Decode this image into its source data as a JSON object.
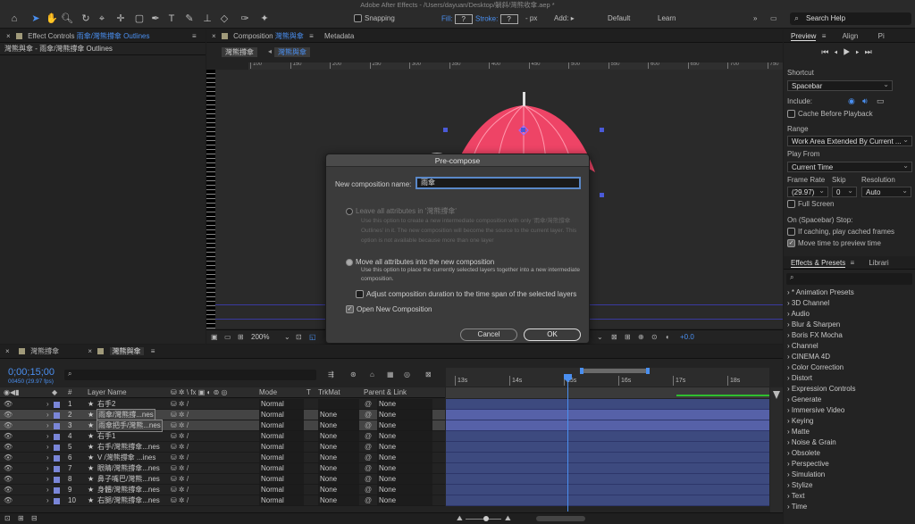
{
  "titlebar": {
    "text": "Adobe After Effects - /Users/dayuan/Desktop/躺斜/灣熊收傘.aep *"
  },
  "toolbar": {
    "snapping_label": "Snapping",
    "fill_label": "Fill:",
    "fill_value": "?",
    "stroke_label": "Stroke:",
    "stroke_value": "?",
    "stroke_px": "- px",
    "add_label": "Add:",
    "workspace_default": "Default",
    "workspace_learn": "Learn",
    "search_placeholder": "Search Help"
  },
  "effect_controls": {
    "tab_label": "Effect Controls",
    "tab_layer": "雨傘/灣熊撐傘 Outlines",
    "subheader": "灣熊與傘 - 雨傘/灣熊撐傘 Outlines"
  },
  "composition": {
    "tab_label": "Composition",
    "tab_name": "灣熊與傘",
    "metadata_tab": "Metadata",
    "breadcrumb_1": "灣熊撐傘",
    "breadcrumb_2": "灣熊與傘",
    "ruler_ticks": [
      "100",
      "150",
      "200",
      "250",
      "300",
      "350",
      "400",
      "450",
      "500",
      "550",
      "600",
      "650",
      "700",
      "750"
    ],
    "zoom": "200%",
    "exposure": "+0.0"
  },
  "dialog": {
    "title": "Pre-compose",
    "name_label": "New composition name:",
    "name_value": "雨傘",
    "opt1_label": "Leave all attributes in '灣熊撐傘'",
    "opt1_desc": "Use this option to create a new intermediate composition with only '雨傘/灣熊撐傘 Outlines' in it. The new composition will become the source to the current layer. This option is not available because more than one layer",
    "opt2_label": "Move all attributes into the new composition",
    "opt2_desc": "Use this option to place the currently selected layers together into a new intermediate composition.",
    "adjust_label": "Adjust composition duration to the time span of the selected layers",
    "open_label": "Open New Composition",
    "cancel": "Cancel",
    "ok": "OK"
  },
  "preview": {
    "tab_preview": "Preview",
    "tab_align": "Align",
    "tab_pi": "Pi",
    "shortcut_label": "Shortcut",
    "shortcut_value": "Spacebar",
    "include_label": "Include:",
    "cache_label": "Cache Before Playback",
    "range_label": "Range",
    "range_value": "Work Area Extended By Current ...",
    "play_from_label": "Play From",
    "play_from_value": "Current Time",
    "frame_rate_label": "Frame Rate",
    "frame_rate_value": "(29.97)",
    "skip_label": "Skip",
    "skip_value": "0",
    "resolution_label": "Resolution",
    "resolution_value": "Auto",
    "full_screen_label": "Full Screen",
    "stop_label": "On (Spacebar) Stop:",
    "if_caching_label": "If caching, play cached frames",
    "move_time_label": "Move time to preview time"
  },
  "effects": {
    "tab_effects": "Effects & Presets",
    "tab_libraries": "Librari",
    "items": [
      "* Animation Presets",
      "3D Channel",
      "Audio",
      "Blur & Sharpen",
      "Boris FX Mocha",
      "Channel",
      "CINEMA 4D",
      "Color Correction",
      "Distort",
      "Expression Controls",
      "Generate",
      "Immersive Video",
      "Keying",
      "Matte",
      "Noise & Grain",
      "Obsolete",
      "Perspective",
      "Simulation",
      "Stylize",
      "Text",
      "Time"
    ]
  },
  "timeline": {
    "tab_1": "灣熊撐傘",
    "tab_2": "灣熊與傘",
    "timecode": "0;00;15;00",
    "frames": "00450 (29.97 fps)",
    "col_num": "#",
    "col_layer_name": "Layer Name",
    "col_mode": "Mode",
    "col_t": "T",
    "col_trkmat": "TrkMat",
    "col_parent": "Parent & Link",
    "time_ticks": [
      "13s",
      "14s",
      "15s",
      "16s",
      "17s",
      "18s"
    ],
    "layers": [
      {
        "num": "1",
        "name": "右手2",
        "mode": "Normal",
        "trkmat": "",
        "parent": "None",
        "color": "#7a86d8"
      },
      {
        "num": "2",
        "name": "雨傘/灣熊撐...nes",
        "mode": "Normal",
        "trkmat": "None",
        "parent": "None",
        "color": "#7a86d8"
      },
      {
        "num": "3",
        "name": "雨傘把手/灣熊...nes",
        "mode": "Normal",
        "trkmat": "None",
        "parent": "None",
        "color": "#7a86d8"
      },
      {
        "num": "4",
        "name": "右手1",
        "mode": "Normal",
        "trkmat": "None",
        "parent": "None",
        "color": "#7a86d8"
      },
      {
        "num": "5",
        "name": "右手/灣熊撐傘...nes",
        "mode": "Normal",
        "trkmat": "None",
        "parent": "None",
        "color": "#7a86d8"
      },
      {
        "num": "6",
        "name": "V /灣熊撐傘 ...ines",
        "mode": "Normal",
        "trkmat": "None",
        "parent": "None",
        "color": "#7a86d8"
      },
      {
        "num": "7",
        "name": "眼睛/灣熊撐傘...nes",
        "mode": "Normal",
        "trkmat": "None",
        "parent": "None",
        "color": "#7a86d8"
      },
      {
        "num": "8",
        "name": "鼻子嘴巴/灣熊...nes",
        "mode": "Normal",
        "trkmat": "None",
        "parent": "None",
        "color": "#7a86d8"
      },
      {
        "num": "9",
        "name": "身體/灣熊撐傘...nes",
        "mode": "Normal",
        "trkmat": "None",
        "parent": "None",
        "color": "#7a86d8"
      },
      {
        "num": "10",
        "name": "右腿/灣熊撐傘...nes",
        "mode": "Normal",
        "trkmat": "None",
        "parent": "None",
        "color": "#7a86d8"
      }
    ]
  },
  "colors": {
    "accent": "#4a8ff0",
    "umbrella": "#ee4466",
    "layer_bar": "#3d4a7f"
  }
}
